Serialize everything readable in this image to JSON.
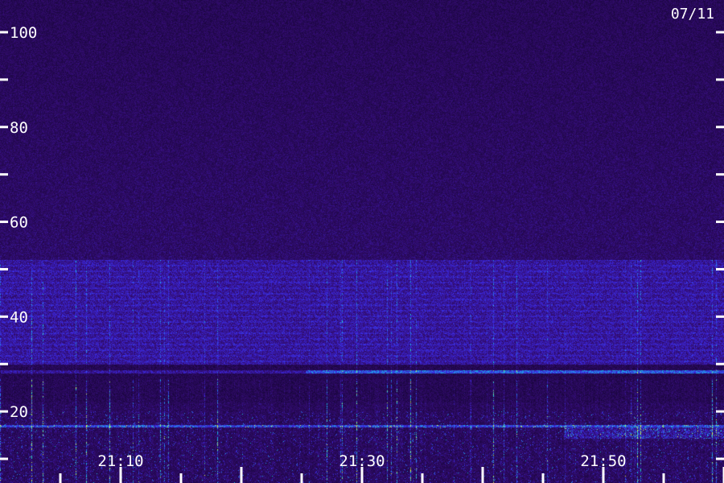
{
  "chart_data": {
    "type": "heatmap",
    "title": "",
    "xlabel": "",
    "ylabel": "",
    "date_label": "07/11",
    "y_range": [
      0,
      100
    ],
    "y_tick_labels": [
      "100",
      "80",
      "60",
      "40",
      "20"
    ],
    "y_tick_values": [
      100,
      80,
      60,
      40,
      20
    ],
    "y_minor_ticks": [
      90,
      70,
      50,
      30,
      10,
      0
    ],
    "x_tick_labels": [
      "21:10",
      "21:30",
      "21:50"
    ],
    "x_tick_values": [
      10,
      30,
      50
    ],
    "x_range_minutes": [
      2,
      62
    ],
    "features": {
      "noise_band": [
        30,
        52
      ],
      "persistent_lines": [
        28.5,
        17
      ]
    },
    "colors": {
      "background": "#2a0c5a",
      "low": "#1a0640",
      "mid": "#3a20c0",
      "high": "#20e0ff",
      "peak": "#e0ff40",
      "text": "#ffffff"
    }
  }
}
